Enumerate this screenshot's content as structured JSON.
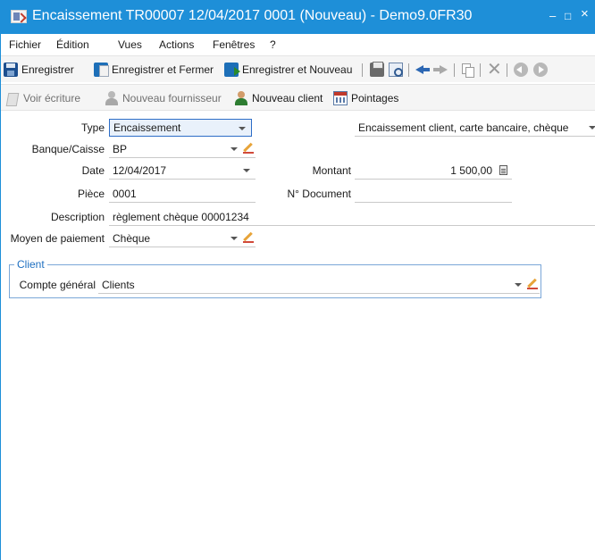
{
  "window": {
    "title": "Encaissement TR00007 12/04/2017 0001 (Nouveau) - Demo9.0FR30",
    "minimize": "–",
    "maximize": "□",
    "close": "×"
  },
  "menu": [
    "Fichier",
    "Édition",
    "Vues",
    "Actions",
    "Fenêtres",
    "?"
  ],
  "toolbar1": {
    "save": "Enregistrer",
    "save_close": "Enregistrer et Fermer",
    "save_new": "Enregistrer et Nouveau",
    "icons": [
      "print-icon",
      "print-preview-icon",
      "back-arrow-icon",
      "forward-arrow-icon",
      "copy-icon",
      "delete-icon",
      "previous-record-icon",
      "next-record-icon"
    ],
    "delete_glyph": "✕"
  },
  "toolbar2": {
    "view_entry": "Voir écriture",
    "new_supplier": "Nouveau fournisseur",
    "new_client": "Nouveau client",
    "reconciliations": "Pointages"
  },
  "form": {
    "type": {
      "label": "Type",
      "value": "Encaissement",
      "description": "Encaissement client, carte bancaire, chèque"
    },
    "bank": {
      "label": "Banque/Caisse",
      "value": "BP"
    },
    "date": {
      "label": "Date",
      "value": "12/04/2017"
    },
    "amount": {
      "label": "Montant",
      "value": "1 500,00"
    },
    "piece": {
      "label": "Pièce",
      "value": "0001"
    },
    "document_number": {
      "label": "N° Document",
      "value": ""
    },
    "description": {
      "label": "Description",
      "value": "règlement chèque 00001234"
    },
    "payment_method": {
      "label": "Moyen de paiement",
      "value": "Chèque"
    }
  },
  "client_group": {
    "legend": "Client",
    "account": {
      "label": "Compte général",
      "value": "Clients"
    }
  },
  "colors": {
    "title_bar": "#1e8fd8",
    "group_border": "#7aa7d8",
    "legend_text": "#1e6fc0"
  }
}
